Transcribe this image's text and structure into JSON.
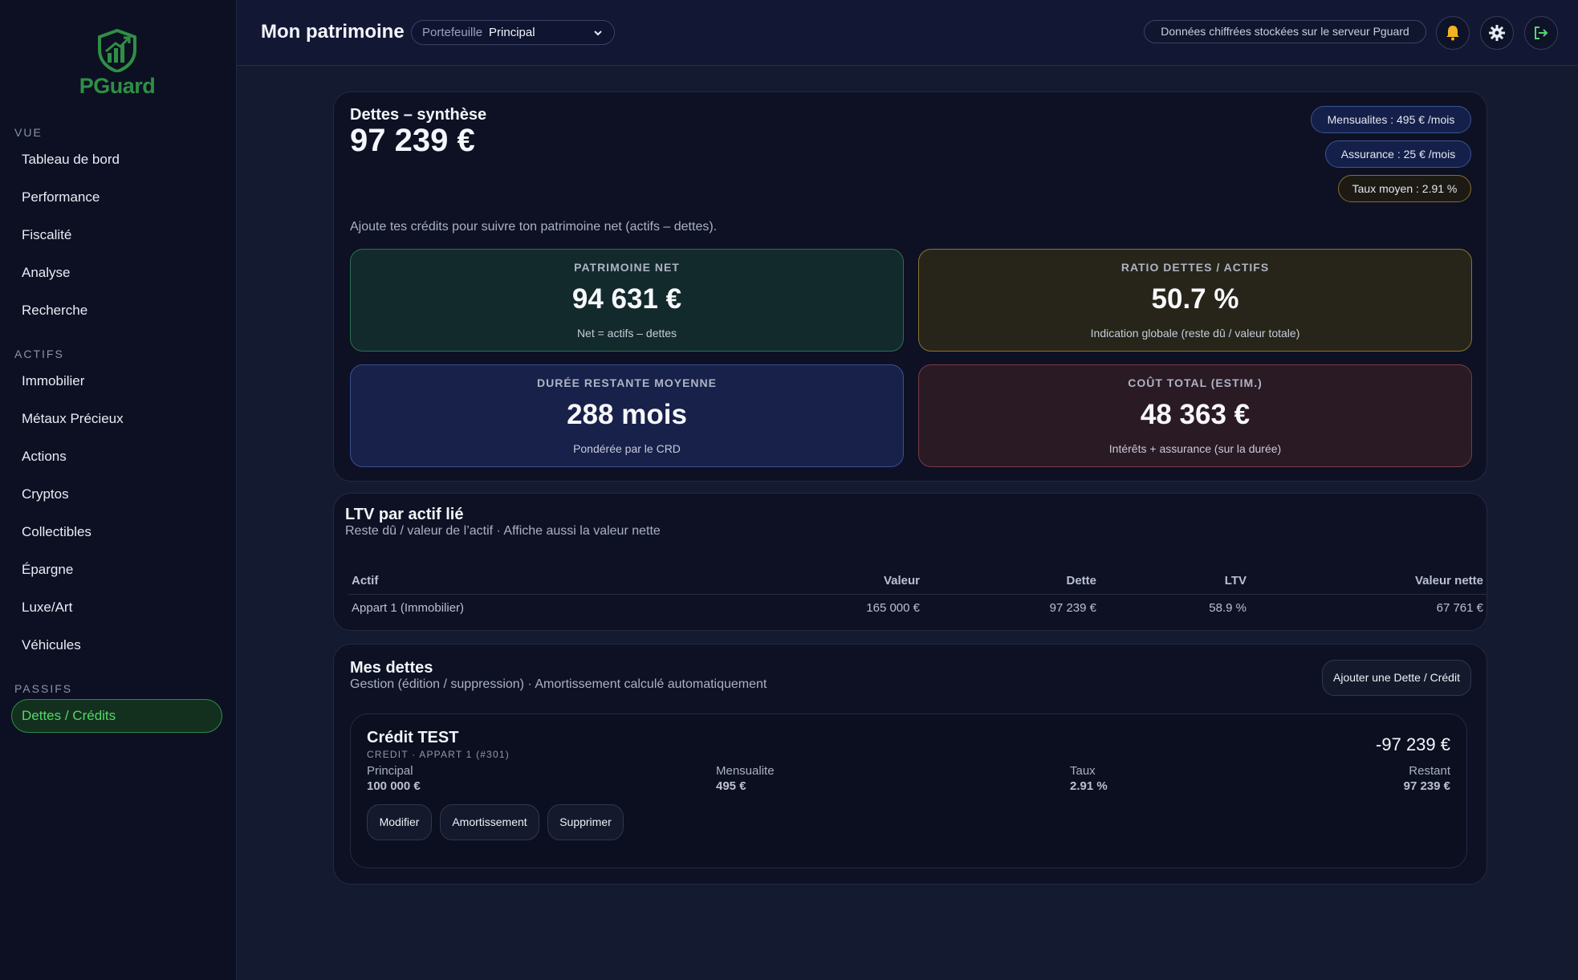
{
  "brand": {
    "name": "PGuard"
  },
  "sidebar": {
    "sections": [
      {
        "title": "VUE",
        "items": [
          "Tableau de bord",
          "Performance",
          "Fiscalité",
          "Analyse",
          "Recherche"
        ]
      },
      {
        "title": "ACTIFS",
        "items": [
          "Immobilier",
          "Métaux Précieux",
          "Actions",
          "Cryptos",
          "Collectibles",
          "Épargne",
          "Luxe/Art",
          "Véhicules"
        ]
      },
      {
        "title": "PASSIFS",
        "items": [
          "Dettes / Crédits"
        ]
      }
    ],
    "active_item": "Dettes / Crédits"
  },
  "header": {
    "title": "Mon patrimoine",
    "portfolio_label": "Portefeuille",
    "portfolio_value": "Principal",
    "encryption_badge": "Données chiffrées stockées sur le serveur Pguard",
    "icons": [
      "bell-icon",
      "gear-icon",
      "logout-icon"
    ]
  },
  "summary": {
    "title": "Dettes – synthèse",
    "total": "97 239 €",
    "pills": {
      "monthly": "Mensualites : 495 € /mois",
      "insurance": "Assurance : 25 € /mois",
      "avg_rate": "Taux moyen : 2.91 %"
    },
    "hint": "Ajoute tes crédits pour suivre ton patrimoine net (actifs – dettes).",
    "kpis": {
      "net_worth": {
        "label": "PATRIMOINE NET",
        "value": "94 631 €",
        "sub": "Net = actifs – dettes"
      },
      "debt_ratio": {
        "label": "RATIO DETTES / ACTIFS",
        "value": "50.7 %",
        "sub": "Indication globale (reste dû / valeur totale)"
      },
      "avg_duration": {
        "label": "DURÉE RESTANTE MOYENNE",
        "value": "288 mois",
        "sub": "Pondérée par le CRD"
      },
      "total_cost": {
        "label": "COÛT TOTAL (ESTIM.)",
        "value": "48 363 €",
        "sub": "Intérêts + assurance (sur la durée)"
      }
    }
  },
  "ltv": {
    "title": "LTV par actif lié",
    "subtitle": "Reste dû / valeur de l’actif · Affiche aussi la valeur nette",
    "columns": {
      "asset": "Actif",
      "value": "Valeur",
      "debt": "Dette",
      "ltv": "LTV",
      "net": "Valeur nette"
    },
    "rows": [
      {
        "asset": "Appart 1 (Immobilier)",
        "value": "165 000 €",
        "debt": "97 239 €",
        "ltv": "58.9 %",
        "net": "67 761 €"
      }
    ]
  },
  "debts": {
    "title": "Mes dettes",
    "subtitle": "Gestion (édition / suppression) · Amortissement calculé automatiquement",
    "add_button": "Ajouter une Dette / Crédit",
    "items": [
      {
        "name": "Crédit TEST",
        "meta": "CREDIT · APPART 1 (#301)",
        "amount": "-97 239 €",
        "principal_label": "Principal",
        "principal": "100 000 €",
        "monthly_label": "Mensualite",
        "monthly": "495 €",
        "rate_label": "Taux",
        "rate": "2.91 %",
        "remaining_label": "Restant",
        "remaining": "97 239 €",
        "actions": {
          "edit": "Modifier",
          "schedule": "Amortissement",
          "delete": "Supprimer"
        }
      }
    ]
  },
  "colors": {
    "accent": "#55d66a",
    "brand": "#2f8f45",
    "background": "#141a30"
  }
}
